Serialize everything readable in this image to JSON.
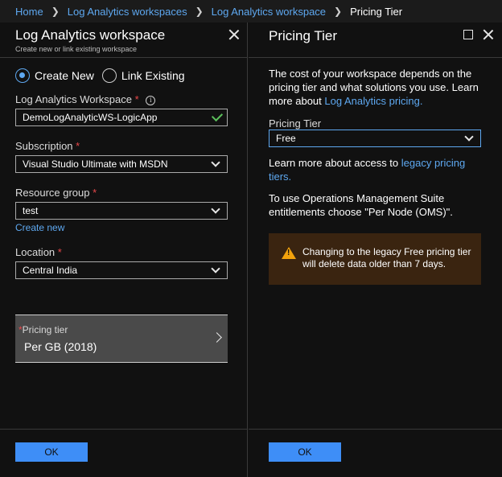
{
  "breadcrumb": {
    "items": [
      "Home",
      "Log Analytics workspaces",
      "Log Analytics workspace"
    ],
    "current": "Pricing Tier"
  },
  "left_panel": {
    "title": "Log Analytics workspace",
    "subtitle": "Create new or link existing workspace",
    "radio_create_new": "Create New",
    "radio_link_existing": "Link Existing",
    "workspace_label": "Log Analytics Workspace",
    "workspace_value": "DemoLogAnalyticWS-LogicApp",
    "subscription_label": "Subscription",
    "subscription_value": "Visual Studio Ultimate with MSDN",
    "resource_group_label": "Resource group",
    "resource_group_value": "test",
    "create_new_link": "Create new",
    "location_label": "Location",
    "location_value": "Central India",
    "pricing_tier_label": "Pricing tier",
    "pricing_tier_value": "Per GB (2018)",
    "ok_label": "OK",
    "required_mark": "*"
  },
  "right_panel": {
    "title": "Pricing Tier",
    "intro_text": "The cost of your workspace depends on the pricing tier and what solutions you use. Learn more about ",
    "intro_link": "Log Analytics pricing.",
    "tier_label": "Pricing Tier",
    "tier_value": "Free",
    "access_text": "Learn more about access to ",
    "access_link": "legacy pricing tiers.",
    "oms_text": "To use Operations Management Suite entitlements choose \"Per Node (OMS)\".",
    "warning_text": "Changing to the legacy Free pricing tier will delete data older than 7 days.",
    "ok_label": "OK"
  },
  "colors": {
    "accent": "#3e8ef7",
    "link": "#5ea8f0",
    "required": "#e8484a",
    "warning": "#f2a20c",
    "success": "#5bbf5b"
  }
}
